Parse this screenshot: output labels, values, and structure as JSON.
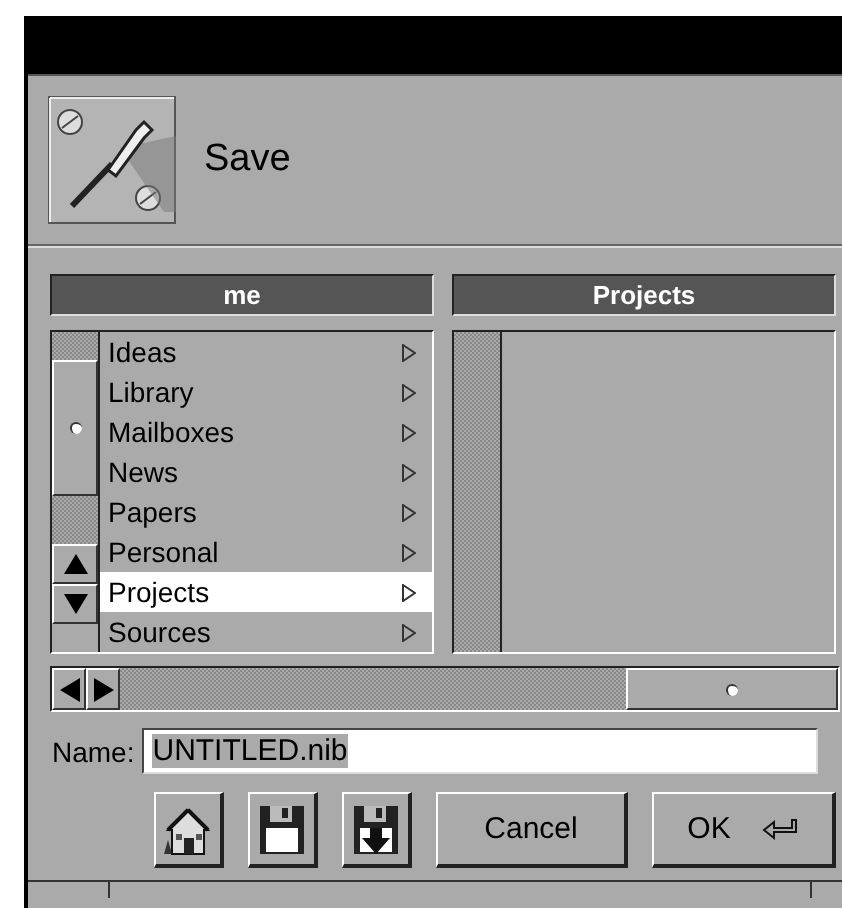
{
  "panel": {
    "title": "Save"
  },
  "browser": {
    "columns": [
      {
        "title": "me",
        "items": [
          {
            "label": "Ideas",
            "selected": false
          },
          {
            "label": "Library",
            "selected": false
          },
          {
            "label": "Mailboxes",
            "selected": false
          },
          {
            "label": "News",
            "selected": false
          },
          {
            "label": "Papers",
            "selected": false
          },
          {
            "label": "Personal",
            "selected": false
          },
          {
            "label": "Projects",
            "selected": true
          },
          {
            "label": "Sources",
            "selected": false
          }
        ]
      },
      {
        "title": "Projects"
      }
    ]
  },
  "name_field": {
    "label": "Name:",
    "value": "UNTITLED.nib"
  },
  "buttons": [
    {
      "kind": "home"
    },
    {
      "kind": "disk"
    },
    {
      "kind": "disk-arrow"
    },
    {
      "kind": "text",
      "label": "Cancel",
      "return_key": false
    },
    {
      "kind": "text",
      "label": "OK",
      "return_key": true
    }
  ]
}
